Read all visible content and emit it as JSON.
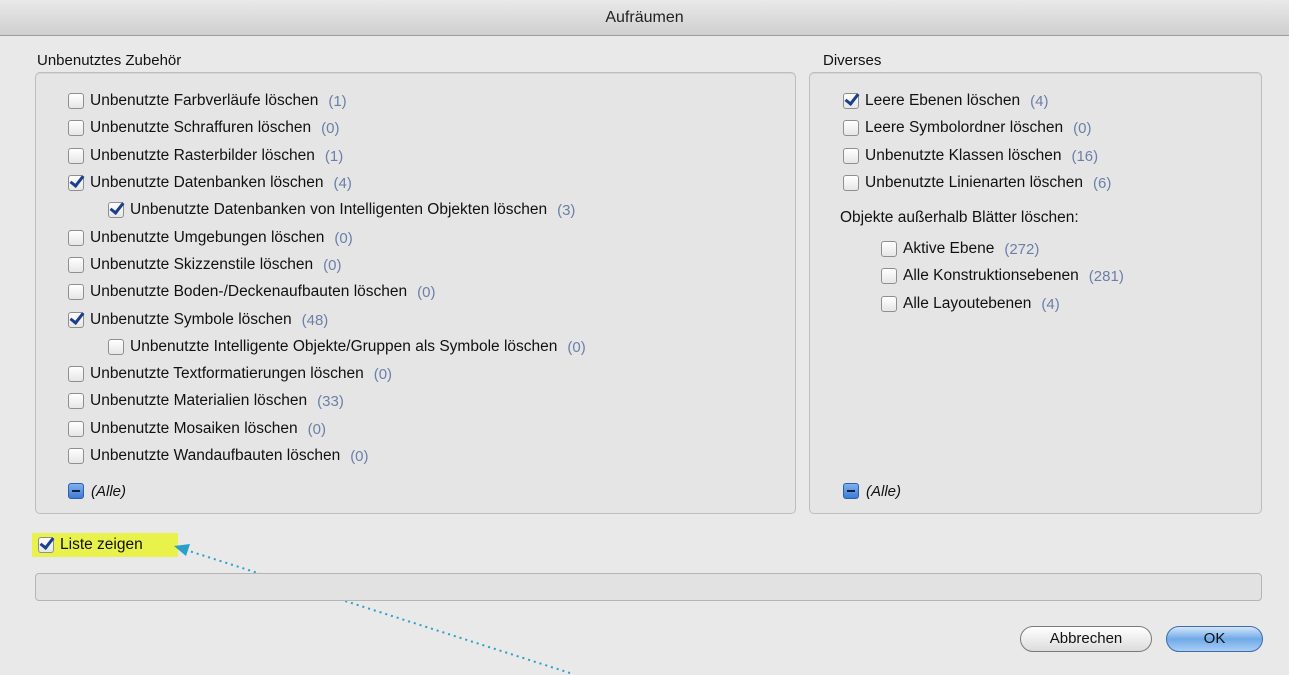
{
  "window": {
    "title": "Aufräumen"
  },
  "left_group": {
    "title": "Unbenutztes Zubehör",
    "items": [
      {
        "label": "Unbenutzte Farbverläufe löschen",
        "count": "(1)",
        "checked": false
      },
      {
        "label": "Unbenutzte Schraffuren löschen",
        "count": "(0)",
        "checked": false
      },
      {
        "label": "Unbenutzte Rasterbilder löschen",
        "count": "(1)",
        "checked": false
      },
      {
        "label": "Unbenutzte Datenbanken löschen",
        "count": "(4)",
        "checked": true
      },
      {
        "label": "Unbenutzte Datenbanken von Intelligenten Objekten löschen",
        "count": "(3)",
        "checked": true
      },
      {
        "label": "Unbenutzte Umgebungen löschen",
        "count": "(0)",
        "checked": false
      },
      {
        "label": "Unbenutzte Skizzenstile löschen",
        "count": "(0)",
        "checked": false
      },
      {
        "label": "Unbenutzte Boden-/Deckenaufbauten löschen",
        "count": "(0)",
        "checked": false
      },
      {
        "label": "Unbenutzte Symbole löschen",
        "count": "(48)",
        "checked": true
      },
      {
        "label": "Unbenutzte Intelligente Objekte/Gruppen als Symbole löschen",
        "count": "(0)",
        "checked": false
      },
      {
        "label": "Unbenutzte Textformatierungen löschen",
        "count": "(0)",
        "checked": false
      },
      {
        "label": "Unbenutzte Materialien löschen",
        "count": "(33)",
        "checked": false
      },
      {
        "label": "Unbenutzte Mosaiken löschen",
        "count": "(0)",
        "checked": false
      },
      {
        "label": "Unbenutzte Wandaufbauten löschen",
        "count": "(0)",
        "checked": false
      }
    ],
    "all_label": "(Alle)"
  },
  "right_group": {
    "title": "Diverses",
    "items": [
      {
        "label": "Leere Ebenen löschen",
        "count": "(4)",
        "checked": true
      },
      {
        "label": "Leere Symbolordner löschen",
        "count": "(0)",
        "checked": false
      },
      {
        "label": "Unbenutzte Klassen löschen",
        "count": "(16)",
        "checked": false
      },
      {
        "label": "Unbenutzte Linienarten löschen",
        "count": "(6)",
        "checked": false
      }
    ],
    "outside_label": "Objekte außerhalb Blätter löschen:",
    "outside_items": [
      {
        "label": "Aktive Ebene",
        "count": "(272)",
        "checked": false
      },
      {
        "label": "Alle Konstruktionsebenen",
        "count": "(281)",
        "checked": false
      },
      {
        "label": "Alle Layoutebenen",
        "count": "(4)",
        "checked": false
      }
    ],
    "all_label": "(Alle)"
  },
  "show_list": {
    "label": "Liste zeigen",
    "checked": true
  },
  "buttons": {
    "cancel": "Abbrechen",
    "ok": "OK"
  },
  "colors": {
    "highlight": "#e8f24a",
    "arrow": "#2aa0c8",
    "count_text": "#6b7fa8"
  }
}
